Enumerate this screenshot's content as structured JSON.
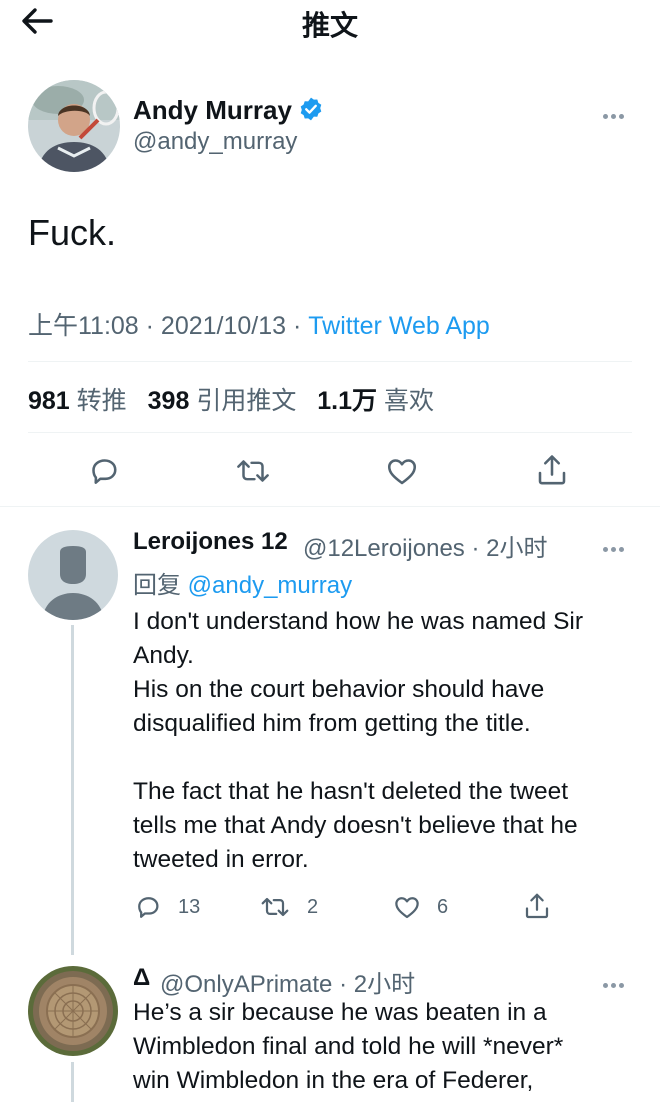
{
  "header": {
    "title": "推文"
  },
  "tweet": {
    "author_name": "Andy Murray",
    "author_handle": "@andy_murray",
    "text": "Fuck.",
    "time": "上午11:08 · 2021/10/13 · ",
    "source": "Twitter Web App",
    "stats": [
      {
        "count": "981",
        "label": "转推"
      },
      {
        "count": "398",
        "label": "引用推文"
      },
      {
        "count": "1.1万",
        "label": "喜欢"
      }
    ]
  },
  "replies": [
    {
      "name": "Leroijones 12",
      "handle": "@12Leroijones · 2小时",
      "reply_prefix": "回复 ",
      "reply_to": "@andy_murray",
      "text": "I don't understand how he was named Sir\nAndy.\nHis on the court behavior should have\ndisqualified him from getting the title.\n\nThe fact that he hasn't deleted the tweet\ntells me that Andy doesn't believe that he\ntweeted in error.",
      "reply_count": "13",
      "retweet_count": "2",
      "like_count": "6"
    },
    {
      "name": "Δ",
      "handle": "@OnlyAPrimate · 2小时",
      "text": "He’s a sir because he was beaten in a\nWimbledon final and told he will *never*\nwin Wimbledon in the era of Federer,"
    }
  ],
  "colors": {
    "accent": "#1d9bf0",
    "secondary_text": "#536471",
    "divider": "#eff3f4"
  },
  "icons": [
    "back-arrow-icon",
    "verified-badge-icon",
    "more-icon",
    "reply-icon",
    "retweet-icon",
    "like-icon",
    "share-icon"
  ]
}
